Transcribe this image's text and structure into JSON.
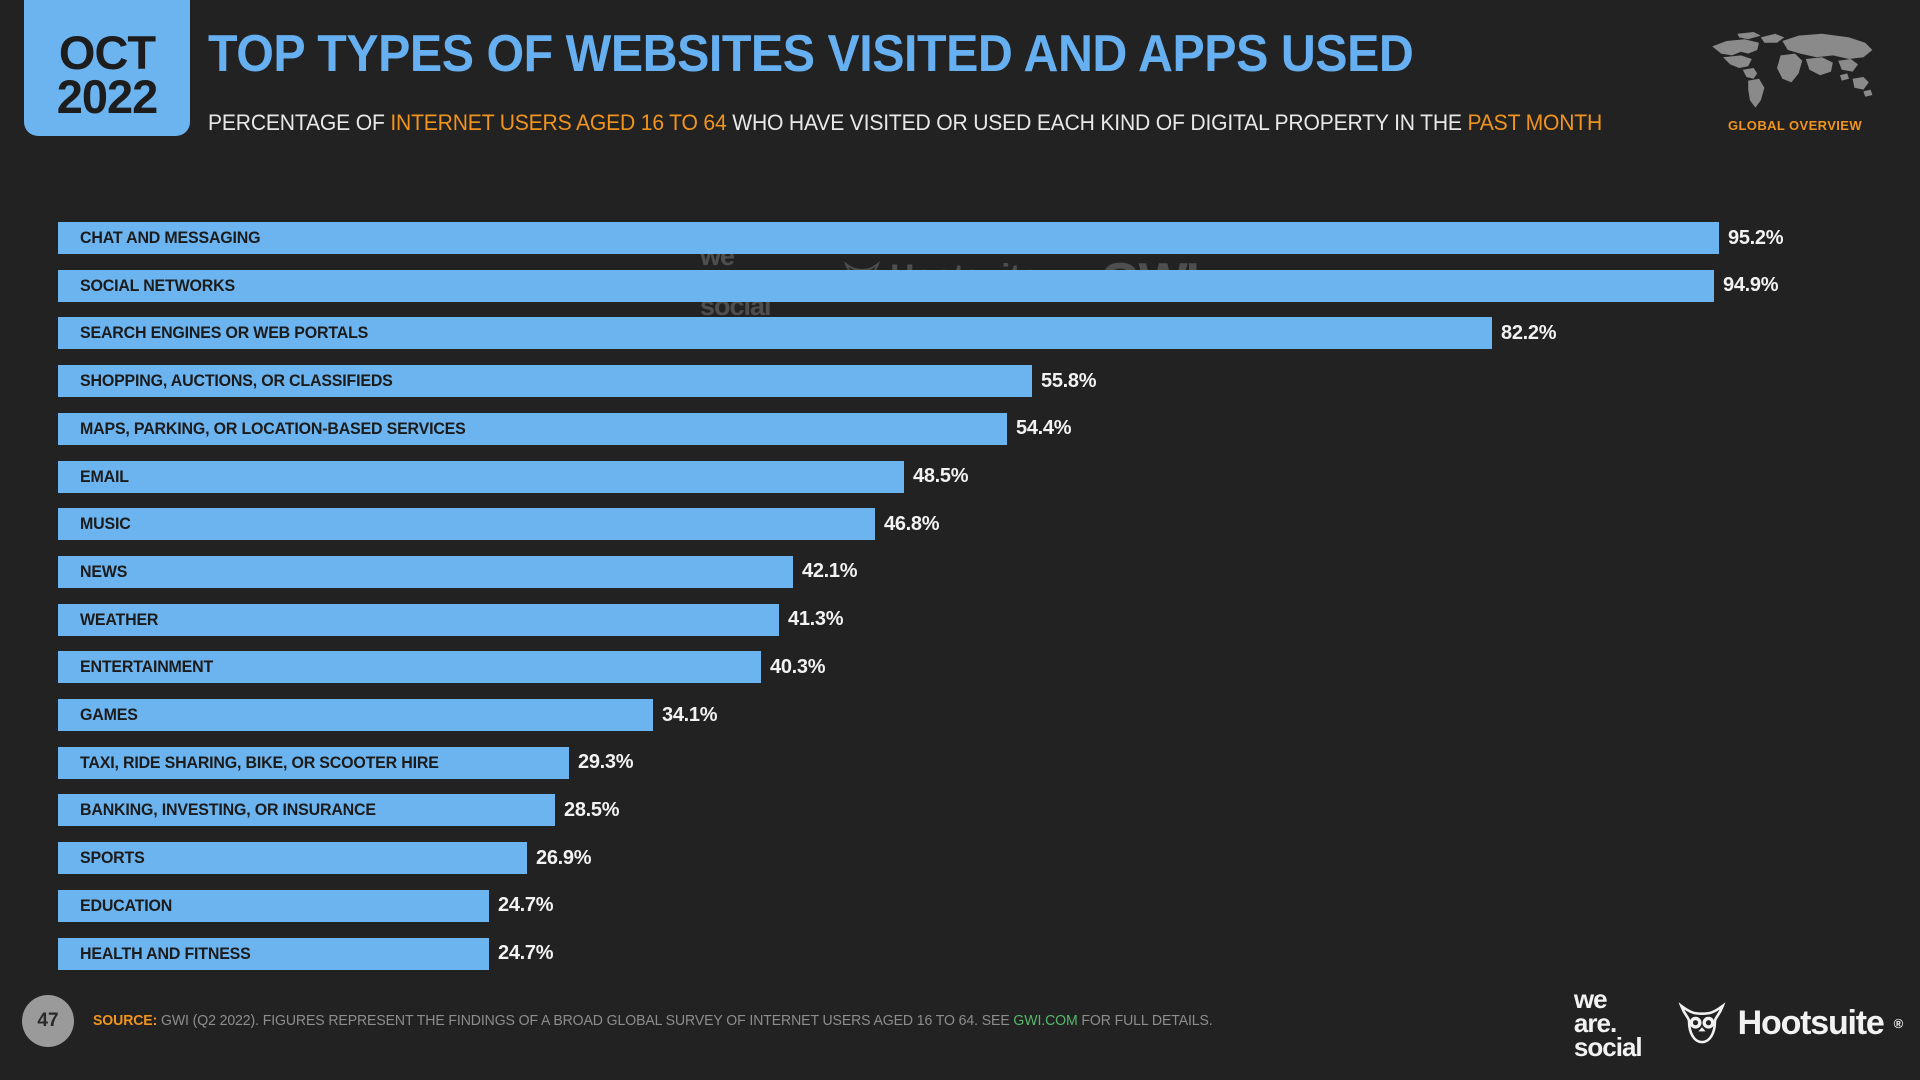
{
  "header": {
    "date_month": "OCT",
    "date_year": "2022",
    "title": "TOP TYPES OF WEBSITES VISITED AND APPS USED",
    "subtitle_parts": [
      {
        "text": "PERCENTAGE OF ",
        "highlight": false
      },
      {
        "text": "INTERNET USERS AGED 16 TO 64",
        "highlight": true
      },
      {
        "text": " WHO HAVE VISITED OR USED EACH KIND OF DIGITAL PROPERTY IN THE ",
        "highlight": false
      },
      {
        "text": "PAST MONTH",
        "highlight": true
      }
    ],
    "map_caption": "GLOBAL OVERVIEW"
  },
  "watermarks": {
    "we_are_social": "we\nare.\nsocial",
    "hootsuite": "Hootsuite",
    "gwi": "GWI."
  },
  "chart_data": {
    "type": "bar",
    "orientation": "horizontal",
    "title": "TOP TYPES OF WEBSITES VISITED AND APPS USED",
    "subtitle": "PERCENTAGE OF INTERNET USERS AGED 16 TO 64 WHO HAVE VISITED OR USED EACH KIND OF DIGITAL PROPERTY IN THE PAST MONTH",
    "xlabel": "",
    "ylabel": "",
    "xlim": [
      0,
      100
    ],
    "grid": false,
    "legend": "none",
    "unit": "%",
    "categories": [
      "CHAT AND MESSAGING",
      "SOCIAL NETWORKS",
      "SEARCH ENGINES OR WEB PORTALS",
      "SHOPPING, AUCTIONS, OR CLASSIFIEDS",
      "MAPS, PARKING, OR LOCATION-BASED SERVICES",
      "EMAIL",
      "MUSIC",
      "NEWS",
      "WEATHER",
      "ENTERTAINMENT",
      "GAMES",
      "TAXI, RIDE SHARING, BIKE, OR SCOOTER HIRE",
      "BANKING, INVESTING, OR INSURANCE",
      "SPORTS",
      "EDUCATION",
      "HEALTH AND FITNESS"
    ],
    "values": [
      95.2,
      94.9,
      82.2,
      55.8,
      54.4,
      48.5,
      46.8,
      42.1,
      41.3,
      40.3,
      34.1,
      29.3,
      28.5,
      26.9,
      24.7,
      24.7
    ],
    "value_labels": [
      "95.2%",
      "94.9%",
      "82.2%",
      "55.8%",
      "54.4%",
      "48.5%",
      "46.8%",
      "42.1%",
      "41.3%",
      "40.3%",
      "34.1%",
      "29.3%",
      "28.5%",
      "26.9%",
      "24.7%",
      "24.7%"
    ],
    "bar_color": "#6cb4f0",
    "background_color": "#222222",
    "label_color": "#1b1b1b",
    "value_color": "#f2f2f2"
  },
  "footer": {
    "page_number": "47",
    "source_label": "SOURCE:",
    "source_text_before": " GWI (Q2 2022). FIGURES REPRESENT THE FINDINGS OF A BROAD GLOBAL SURVEY OF INTERNET USERS AGED 16 TO 64. SEE ",
    "source_link": "GWI.COM",
    "source_text_after": " FOR FULL DETAILS.",
    "logo_we_are_social": "we\nare.\nsocial",
    "logo_hootsuite": "Hootsuite"
  },
  "colors": {
    "accent_blue": "#6cb4f0",
    "title_blue": "#66aff0",
    "accent_orange": "#f0941e",
    "link_green": "#56b86a",
    "background": "#222222"
  }
}
